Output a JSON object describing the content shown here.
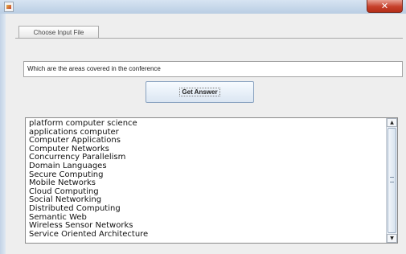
{
  "window": {
    "close_label": "✕"
  },
  "toolbar": {
    "choose_file_label": "Choose Input File"
  },
  "question": {
    "value": "Which are the areas covered in the conference"
  },
  "actions": {
    "get_answer_label": "Get Answer"
  },
  "answers": {
    "items": [
      "platform computer science",
      "applications computer",
      "Computer Applications",
      "Computer Networks",
      "Concurrency Parallelism",
      "Domain Languages",
      "Secure Computing",
      "Mobile Networks",
      "Cloud Computing",
      "Social Networking",
      "Distributed Computing",
      "Semantic Web",
      "Wireless Sensor Networks",
      "Service Oriented Architecture"
    ]
  },
  "scrollbar": {
    "up_arrow": "▲",
    "down_arrow": "▼"
  },
  "icons": {
    "app": "app-icon",
    "close": "close-icon"
  }
}
